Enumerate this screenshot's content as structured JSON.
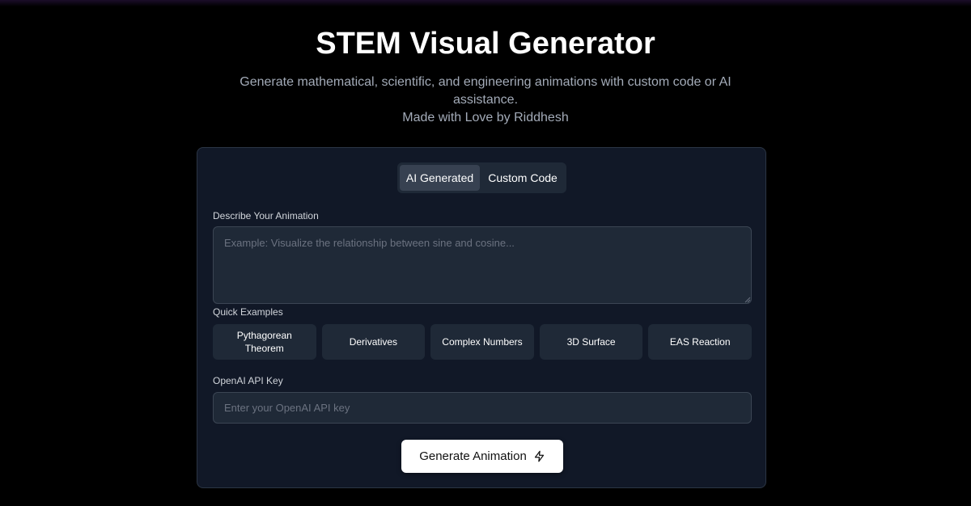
{
  "header": {
    "title": "STEM Visual Generator",
    "subtitle": "Generate mathematical, scientific, and engineering animations with custom code or AI assistance.",
    "credit": "Made with Love by Riddhesh"
  },
  "tabs": [
    {
      "label": "AI Generated",
      "active": true
    },
    {
      "label": "Custom Code",
      "active": false
    }
  ],
  "describe": {
    "label": "Describe Your Animation",
    "placeholder": "Example: Visualize the relationship between sine and cosine...",
    "value": ""
  },
  "quick_examples": {
    "label": "Quick Examples",
    "items": [
      "Pythagorean Theorem",
      "Derivatives",
      "Complex Numbers",
      "3D Surface",
      "EAS Reaction"
    ]
  },
  "api_key": {
    "label": "OpenAI API Key",
    "placeholder": "Enter your OpenAI API key",
    "value": ""
  },
  "generate": {
    "label": "Generate Animation",
    "icon": "lightning-bolt-icon"
  },
  "colors": {
    "background": "#000000",
    "card": "#111827",
    "input": "#1f2937",
    "muted_text": "#a3abb8"
  }
}
